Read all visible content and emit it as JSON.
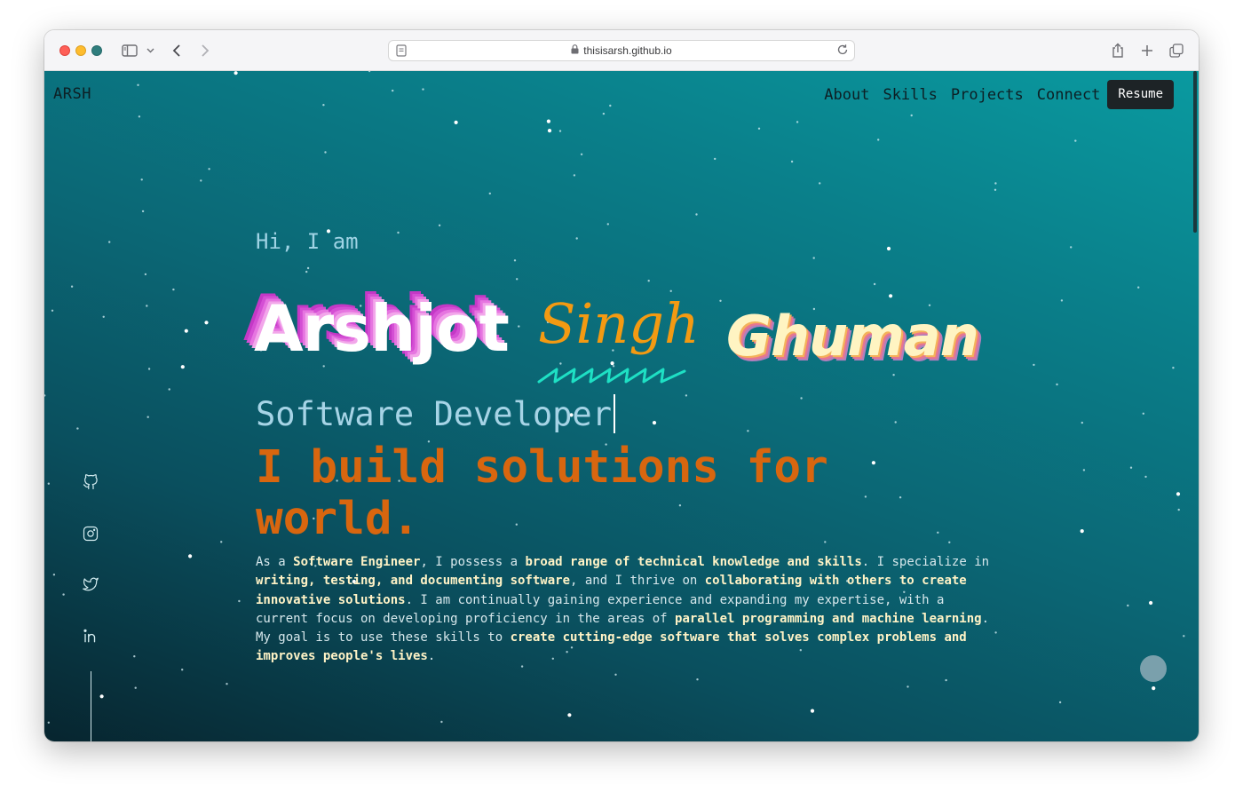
{
  "browser": {
    "url": "thisisarsh.github.io"
  },
  "site": {
    "logo": "ARSH",
    "nav": {
      "about": "About",
      "skills": "Skills",
      "projects": "Projects",
      "connect": "Connect",
      "resume": "Resume"
    },
    "social_icons": [
      "github-icon",
      "instagram-icon",
      "twitter-icon",
      "linkedin-icon"
    ],
    "hero": {
      "greeting": "Hi, I am",
      "first_name": "Arshjot",
      "middle_name": "Singh",
      "last_name": "Ghuman",
      "role": "Software Developer",
      "tagline": "I build solutions for world.",
      "bio": [
        {
          "text": "As a ",
          "bold": false
        },
        {
          "text": "Software Engineer",
          "bold": true
        },
        {
          "text": ", I possess a ",
          "bold": false
        },
        {
          "text": "broad range of technical knowledge and skills",
          "bold": true
        },
        {
          "text": ". I specialize in ",
          "bold": false
        },
        {
          "text": "writing, testing, and documenting software",
          "bold": true
        },
        {
          "text": ", and I thrive on ",
          "bold": false
        },
        {
          "text": "collaborating with others to create innovative solutions",
          "bold": true
        },
        {
          "text": ". I am continually gaining experience and expanding my expertise, with a current focus on developing proficiency in the areas of ",
          "bold": false
        },
        {
          "text": "parallel programming and machine learning",
          "bold": true
        },
        {
          "text": ". My goal is to use these skills to ",
          "bold": false
        },
        {
          "text": "create cutting-edge software that solves complex problems and improves people's lives",
          "bold": true
        },
        {
          "text": ".",
          "bold": false
        }
      ]
    }
  },
  "colors": {
    "accent_orange": "#d8660f",
    "name_magenta": "#d44fd4",
    "name_gold": "#f39a12",
    "squiggle_teal": "#1ee0c4"
  }
}
